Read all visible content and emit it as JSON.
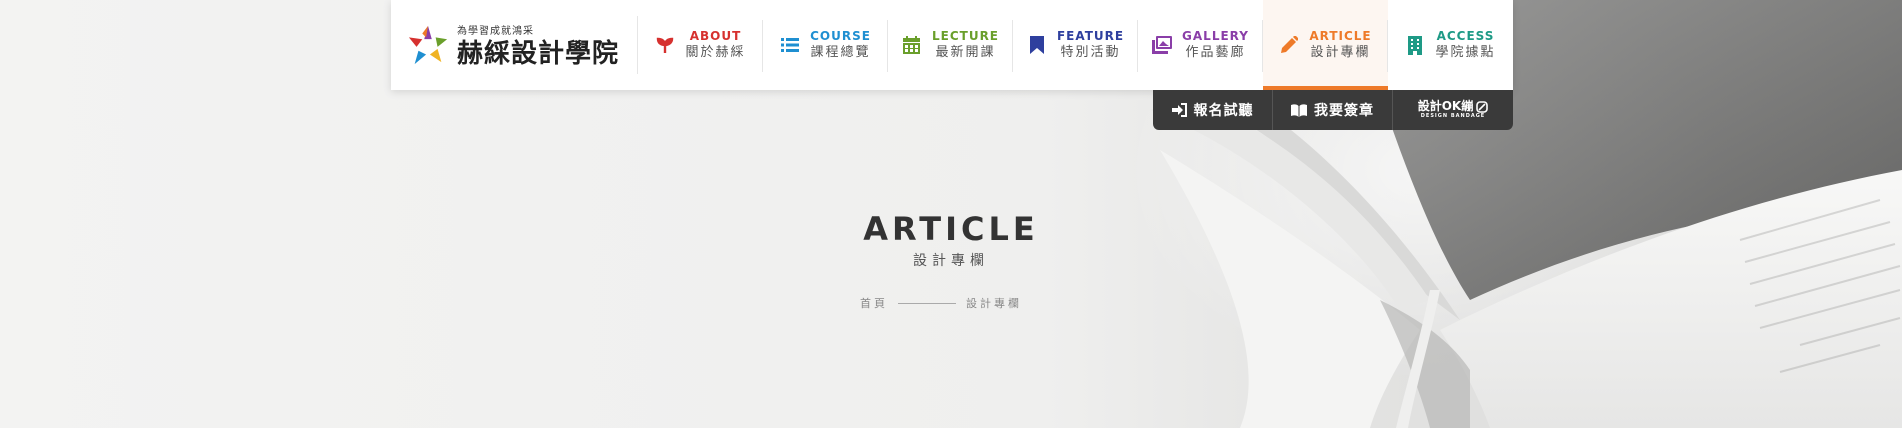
{
  "brand": {
    "slogan": "為學習成就鴻采",
    "name": "赫綵設計學院"
  },
  "nav": [
    {
      "en": "ABOUT",
      "zh": "關於赫綵",
      "color": "#d6312f",
      "icon": "sprout-icon"
    },
    {
      "en": "COURSE",
      "zh": "課程總覽",
      "color": "#1f8fd1",
      "icon": "list-icon"
    },
    {
      "en": "LECTURE",
      "zh": "最新開課",
      "color": "#6a9f2b",
      "icon": "calendar-icon"
    },
    {
      "en": "FEATURE",
      "zh": "特別活動",
      "color": "#2e3f9e",
      "icon": "bookmark-icon"
    },
    {
      "en": "GALLERY",
      "zh": "作品藝廊",
      "color": "#8a3ea8",
      "icon": "images-icon"
    },
    {
      "en": "ARTICLE",
      "zh": "設計專欄",
      "color": "#ee7a29",
      "icon": "pencil-icon"
    },
    {
      "en": "ACCESS",
      "zh": "學院據點",
      "color": "#1e9a86",
      "icon": "building-icon"
    }
  ],
  "subnav": {
    "signup": "報名試聽",
    "bandage": "我要簽章",
    "design_ok": "設計OK繃",
    "design_ok_sub": "DESIGN BANDAGE"
  },
  "page": {
    "title": "ARTICLE",
    "subtitle": "設計專欄"
  },
  "breadcrumb": {
    "home": "首頁",
    "current": "設計專欄"
  }
}
